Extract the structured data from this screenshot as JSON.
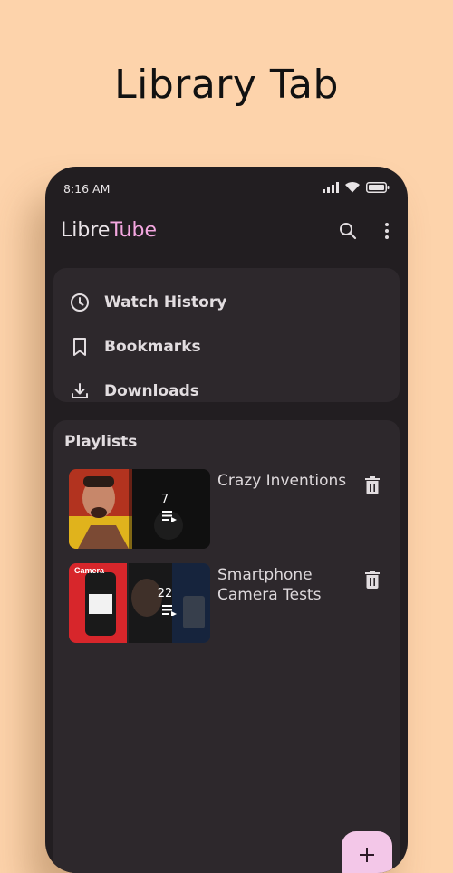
{
  "promo": {
    "title": "Library Tab"
  },
  "status_bar": {
    "time": "8:16 AM",
    "icons": [
      "signal-icon",
      "wifi-icon",
      "battery-icon"
    ]
  },
  "app_bar": {
    "title_part1": "Libre",
    "title_part2": "Tube",
    "actions": [
      "search-icon",
      "more-vert-icon"
    ]
  },
  "library": {
    "items": [
      {
        "label": "Watch History",
        "icon": "clock-icon"
      },
      {
        "label": "Bookmarks",
        "icon": "bookmark-icon"
      },
      {
        "label": "Downloads",
        "icon": "download-icon"
      }
    ]
  },
  "playlists": {
    "heading": "Playlists",
    "items": [
      {
        "name": "Crazy Inventions",
        "count": "7",
        "thumb_text": ""
      },
      {
        "name": "Smartphone Camera Tests",
        "count": "22",
        "thumb_text": "Camera"
      }
    ]
  },
  "colors": {
    "background": "#fdd3ab",
    "surface": "#221e21",
    "card": "#2d282c",
    "accent": "#f4a7e0",
    "fab": "#f3c7e8"
  }
}
